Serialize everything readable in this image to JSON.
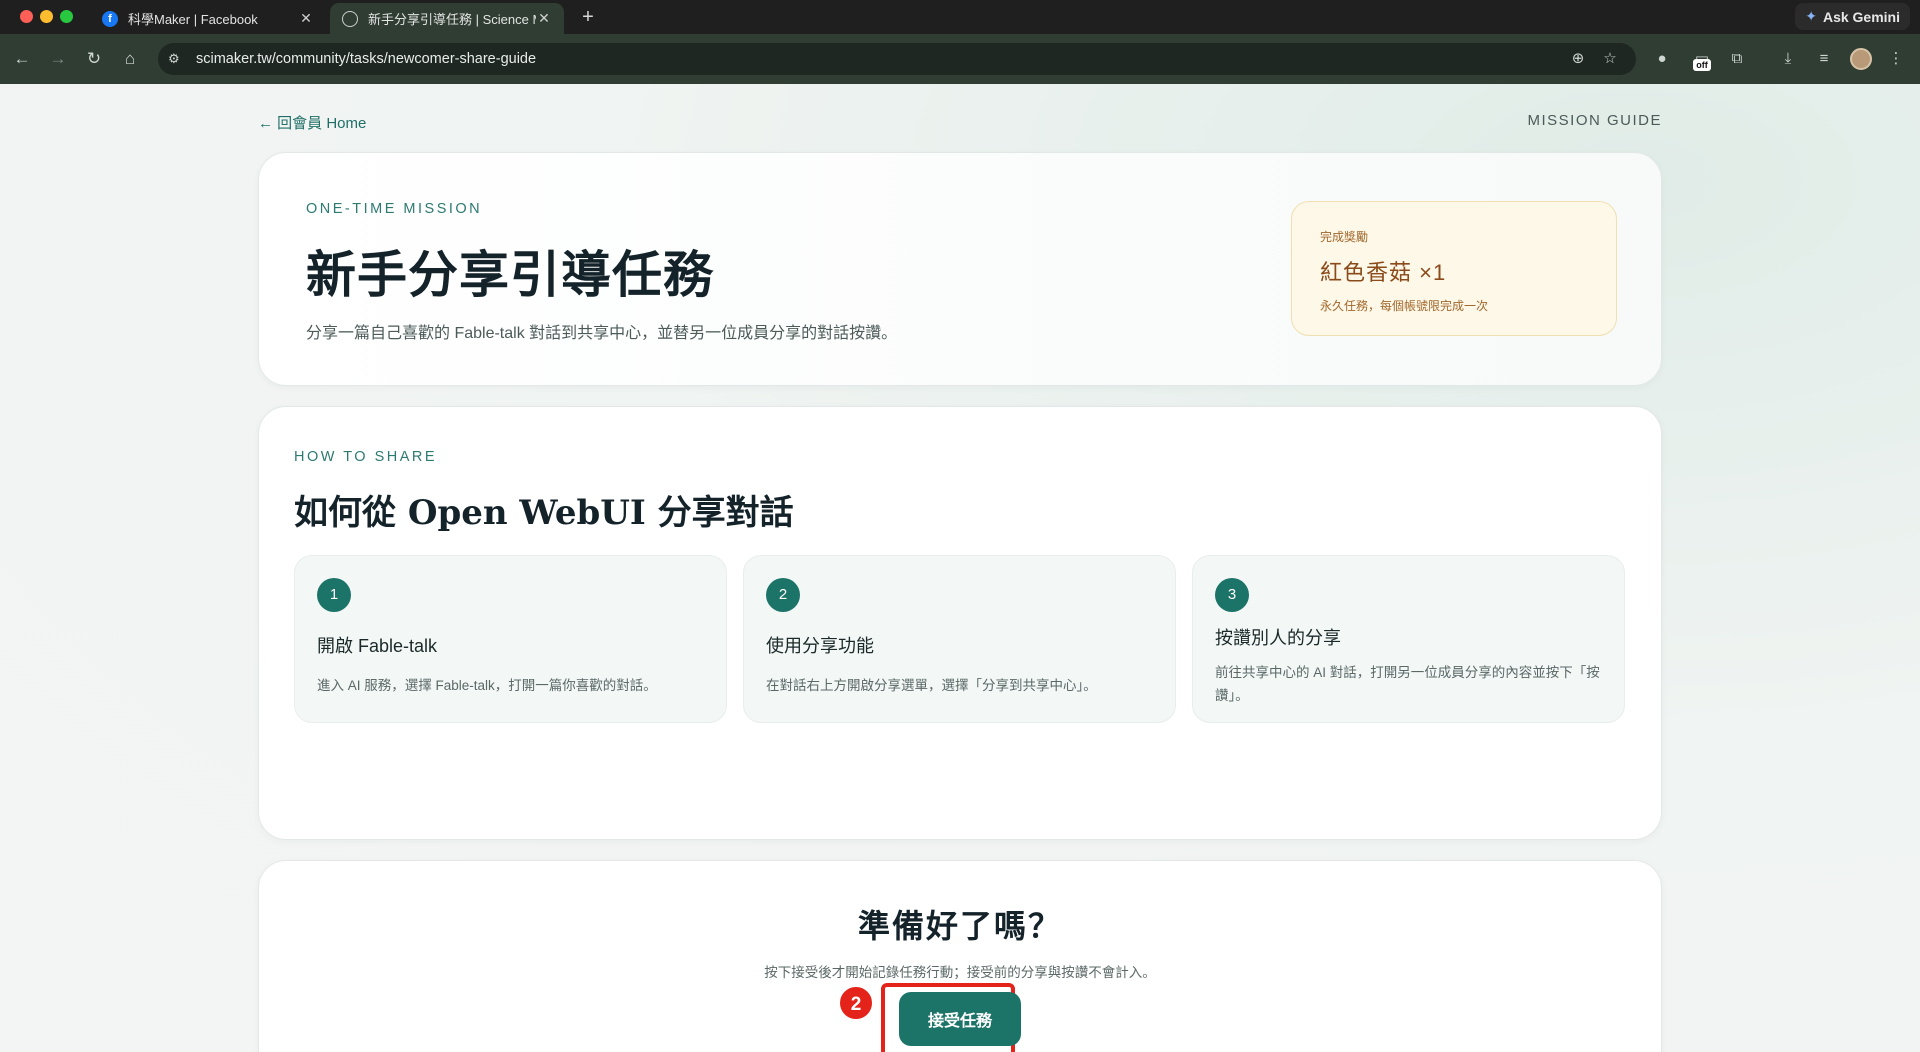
{
  "browser": {
    "tabs": [
      {
        "title": "科學Maker | Facebook",
        "icon": "facebook-icon"
      },
      {
        "title": "新手分享引導任務 | Science M",
        "icon": "globe-icon"
      }
    ],
    "url": "scimaker.tw/community/tasks/newcomer-share-guide",
    "gemini_label": "Ask Gemini",
    "extension_badge": "off"
  },
  "page": {
    "back_link": "← 回會員 Home",
    "guide_label": "MISSION GUIDE"
  },
  "hero": {
    "eyebrow": "ONE-TIME MISSION",
    "title": "新手分享引導任務",
    "subtitle": "分享一篇自己喜歡的 Fable-talk 對話到共享中心，並替另一位成員分享的對話按讚。",
    "reward": {
      "label": "完成獎勵",
      "value": "紅色香菇 ×1",
      "note": "永久任務，每個帳號限完成一次"
    }
  },
  "how_to": {
    "eyebrow": "HOW TO SHARE",
    "title": "如何從 Open WebUI 分享對話",
    "steps": [
      {
        "num": "1",
        "title": "開啟 Fable-talk",
        "desc": "進入 AI 服務，選擇 Fable-talk，打開一篇你喜歡的對話。"
      },
      {
        "num": "2",
        "title": "使用分享功能",
        "desc": "在對話右上方開啟分享選單，選擇「分享到共享中心」。"
      },
      {
        "num": "3",
        "title": "按讚別人的分享",
        "desc": "前往共享中心的 AI 對話，打開另一位成員分享的內容並按下「按讚」。"
      }
    ]
  },
  "cta": {
    "title": "準備好了嗎？",
    "note": "按下接受後才開始記錄任務行動；接受前的分享與按讚不會計入。",
    "button": "接受任務",
    "marker": "2"
  },
  "colors": {
    "accent": "#1c7368",
    "highlight": "#e4231a",
    "reward_bg": "#fef8e8",
    "reward_text": "#8a4a1a"
  }
}
